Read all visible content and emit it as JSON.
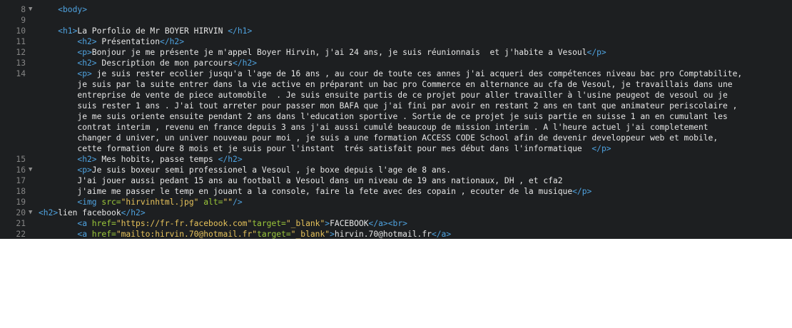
{
  "editor": {
    "lines": [
      {
        "num": "8",
        "fold": "▼",
        "indent": 4,
        "tokens": [
          {
            "t": "tag",
            "v": "<body>"
          }
        ]
      },
      {
        "num": "9",
        "fold": "",
        "indent": 0,
        "tokens": []
      },
      {
        "num": "10",
        "fold": "",
        "indent": 4,
        "tokens": [
          {
            "t": "tag",
            "v": "<h1>"
          },
          {
            "t": "txt",
            "v": "La Porfolio de Mr BOYER HIRVIN "
          },
          {
            "t": "tag",
            "v": "</h1>"
          }
        ]
      },
      {
        "num": "11",
        "fold": "",
        "indent": 8,
        "tokens": [
          {
            "t": "tag",
            "v": "<h2>"
          },
          {
            "t": "txt",
            "v": " Présentation"
          },
          {
            "t": "tag",
            "v": "</h2>"
          }
        ]
      },
      {
        "num": "12",
        "fold": "",
        "indent": 8,
        "tokens": [
          {
            "t": "tag",
            "v": "<p>"
          },
          {
            "t": "txt",
            "v": "Bonjour je me présente je m'appel Boyer Hirvin, j'ai 24 ans, je suis réunionnais  et j'habite a Vesoul"
          },
          {
            "t": "tag",
            "v": "</p>"
          }
        ]
      },
      {
        "num": "13",
        "fold": "",
        "indent": 8,
        "tokens": [
          {
            "t": "tag",
            "v": "<h2>"
          },
          {
            "t": "txt",
            "v": " Description de mon parcours"
          },
          {
            "t": "tag",
            "v": "</h2>"
          }
        ]
      },
      {
        "num": "14",
        "fold": "",
        "indent": 8,
        "tokens": [
          {
            "t": "tag",
            "v": "<p>"
          },
          {
            "t": "txt",
            "v": " je suis rester ecolier jusqu'a l'age de 16 ans , au cour de toute ces annes j'ai acqueri des compétences niveau bac pro Comptabilite,"
          }
        ]
      },
      {
        "num": "",
        "fold": "",
        "indent": 8,
        "tokens": [
          {
            "t": "txt",
            "v": "je suis par la suite entrer dans la vie active en préparant un bac pro Commerce en alternance au cfa de Vesoul, je travaillais dans une"
          }
        ]
      },
      {
        "num": "",
        "fold": "",
        "indent": 8,
        "tokens": [
          {
            "t": "txt",
            "v": "entreprise de vente de piece automobile  . Je suis ensuite partis de ce projet pour aller travailler à l'usine peugeot de vesoul ou je"
          }
        ]
      },
      {
        "num": "",
        "fold": "",
        "indent": 8,
        "tokens": [
          {
            "t": "txt",
            "v": "suis rester 1 ans . J'ai tout arreter pour passer mon BAFA que j'ai fini par avoir en restant 2 ans en tant que animateur periscolaire ,"
          }
        ]
      },
      {
        "num": "",
        "fold": "",
        "indent": 8,
        "tokens": [
          {
            "t": "txt",
            "v": "je me suis oriente ensuite pendant 2 ans dans l'education sportive . Sortie de ce projet je suis partie en suisse 1 an en cumulant les"
          }
        ]
      },
      {
        "num": "",
        "fold": "",
        "indent": 8,
        "tokens": [
          {
            "t": "txt",
            "v": "contrat interim , revenu en france depuis 3 ans j'ai aussi cumulé beaucoup de mission interim . A l'heure actuel j'ai completement"
          }
        ]
      },
      {
        "num": "",
        "fold": "",
        "indent": 8,
        "tokens": [
          {
            "t": "txt",
            "v": "changer d univer, un univer nouveau pour moi , je suis a une formation ACCESS CODE School afin de devenir developpeur web et mobile,"
          }
        ]
      },
      {
        "num": "",
        "fold": "",
        "indent": 8,
        "tokens": [
          {
            "t": "txt",
            "v": "cette formation dure 8 mois et je suis pour l'instant  trés satisfait pour mes début dans l'informatique  "
          },
          {
            "t": "tag",
            "v": "</p>"
          }
        ]
      },
      {
        "num": "15",
        "fold": "",
        "indent": 8,
        "tokens": [
          {
            "t": "tag",
            "v": "<h2>"
          },
          {
            "t": "txt",
            "v": " Mes hobits, passe temps "
          },
          {
            "t": "tag",
            "v": "</h2>"
          }
        ]
      },
      {
        "num": "16",
        "fold": "▼",
        "indent": 8,
        "tokens": [
          {
            "t": "tag",
            "v": "<p>"
          },
          {
            "t": "txt",
            "v": "Je suis boxeur semi professionel a Vesoul , je boxe depuis l'age de 8 ans."
          }
        ]
      },
      {
        "num": "17",
        "fold": "",
        "indent": 8,
        "tokens": [
          {
            "t": "txt",
            "v": "J'ai jouer aussi pedant 15 ans au football a Vesoul dans un niveau de 19 ans nationaux, DH , et cfa2"
          }
        ]
      },
      {
        "num": "18",
        "fold": "",
        "indent": 8,
        "tokens": [
          {
            "t": "txt",
            "v": "j'aime me passer le temp en jouant a la console, faire la fete avec des copain , ecouter de la musique"
          },
          {
            "t": "tag",
            "v": "</p>"
          }
        ]
      },
      {
        "num": "19",
        "fold": "",
        "indent": 8,
        "tokens": [
          {
            "t": "tag",
            "v": "<img "
          },
          {
            "t": "attr",
            "v": "src="
          },
          {
            "t": "str",
            "v": "\"hirvinhtml.jpg\""
          },
          {
            "t": "attr",
            "v": " alt="
          },
          {
            "t": "str",
            "v": "\"\""
          },
          {
            "t": "tag",
            "v": "/>"
          }
        ]
      },
      {
        "num": "20",
        "fold": "▼",
        "indent": 0,
        "tokens": [
          {
            "t": "tag",
            "v": "<h2>"
          },
          {
            "t": "txt",
            "v": "lien facebook"
          },
          {
            "t": "tag",
            "v": "</h2>"
          }
        ]
      },
      {
        "num": "21",
        "fold": "",
        "indent": 8,
        "tokens": [
          {
            "t": "tag",
            "v": "<a "
          },
          {
            "t": "attr",
            "v": "href="
          },
          {
            "t": "str",
            "v": "\"https://fr-fr.facebook.com\""
          },
          {
            "t": "attr",
            "v": "target="
          },
          {
            "t": "str",
            "v": "\"_blank\""
          },
          {
            "t": "tag",
            "v": ">"
          },
          {
            "t": "txt",
            "v": "FACEBOOK"
          },
          {
            "t": "tag",
            "v": "</a><br>"
          }
        ]
      },
      {
        "num": "22",
        "fold": "",
        "indent": 8,
        "tokens": [
          {
            "t": "tag",
            "v": "<a "
          },
          {
            "t": "attr",
            "v": "href="
          },
          {
            "t": "str",
            "v": "\"mailto:hirvin.70@hotmail.fr\""
          },
          {
            "t": "attr",
            "v": "target="
          },
          {
            "t": "str",
            "v": "\"_blank\""
          },
          {
            "t": "tag",
            "v": ">"
          },
          {
            "t": "txt",
            "v": "hirvin.70@hotmail.fr"
          },
          {
            "t": "tag",
            "v": "</a>"
          }
        ]
      }
    ]
  }
}
